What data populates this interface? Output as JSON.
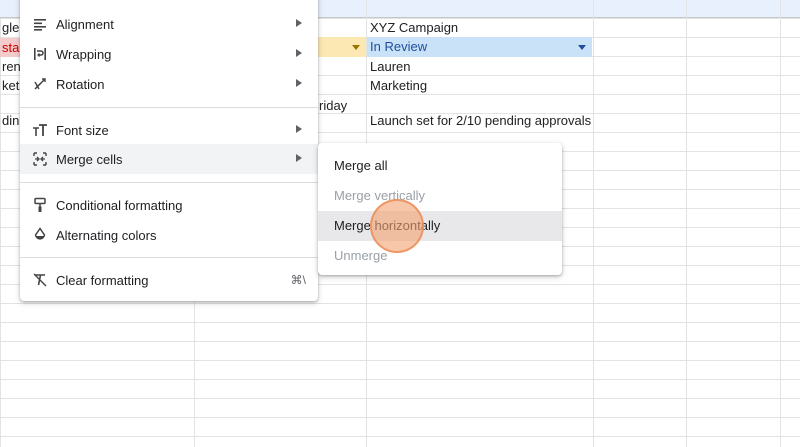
{
  "sheet": {
    "cells": [
      {
        "key": "a1",
        "text": "gle"
      },
      {
        "key": "a2",
        "text": "star"
      },
      {
        "key": "a3",
        "text": "ren"
      },
      {
        "key": "a4",
        "text": "keti"
      },
      {
        "key": "a6",
        "text": "ding"
      },
      {
        "key": "c5",
        "text": "riday"
      },
      {
        "key": "d1",
        "text": "XYZ Campaign"
      },
      {
        "key": "d2",
        "text": "In Review"
      },
      {
        "key": "d3",
        "text": "Lauren"
      },
      {
        "key": "d4",
        "text": "Marketing"
      },
      {
        "key": "d6",
        "text": "Launch set for 2/10 pending approvals"
      }
    ]
  },
  "format_menu": {
    "items": [
      {
        "label": "Alignment",
        "icon": "align-left-icon",
        "submenu": true
      },
      {
        "label": "Wrapping",
        "icon": "text-wrap-icon",
        "submenu": true
      },
      {
        "label": "Rotation",
        "icon": "text-rotation-icon",
        "submenu": true
      },
      {
        "label": "Font size",
        "icon": "font-size-icon",
        "submenu": true
      },
      {
        "label": "Merge cells",
        "icon": "merge-cells-icon",
        "submenu": true
      },
      {
        "label": "Conditional formatting",
        "icon": "paint-roller-icon",
        "submenu": false
      },
      {
        "label": "Alternating colors",
        "icon": "fill-drop-icon",
        "submenu": false
      },
      {
        "label": "Clear formatting",
        "icon": "clear-format-icon",
        "submenu": false,
        "shortcut": "⌘\\"
      }
    ]
  },
  "merge_submenu": {
    "items": [
      {
        "label": "Merge all",
        "enabled": true
      },
      {
        "label": "Merge vertically",
        "enabled": false
      },
      {
        "label": "Merge horizontally",
        "enabled": true
      },
      {
        "label": "Unmerge",
        "enabled": false
      }
    ]
  },
  "colors": {
    "status_red_bg": "#f4cccc",
    "status_yellow_bg": "#fce8b2",
    "status_blue_bg": "#c9e2f8",
    "menu_hover": "#f1f3f4",
    "cursor": "#f4a270"
  }
}
